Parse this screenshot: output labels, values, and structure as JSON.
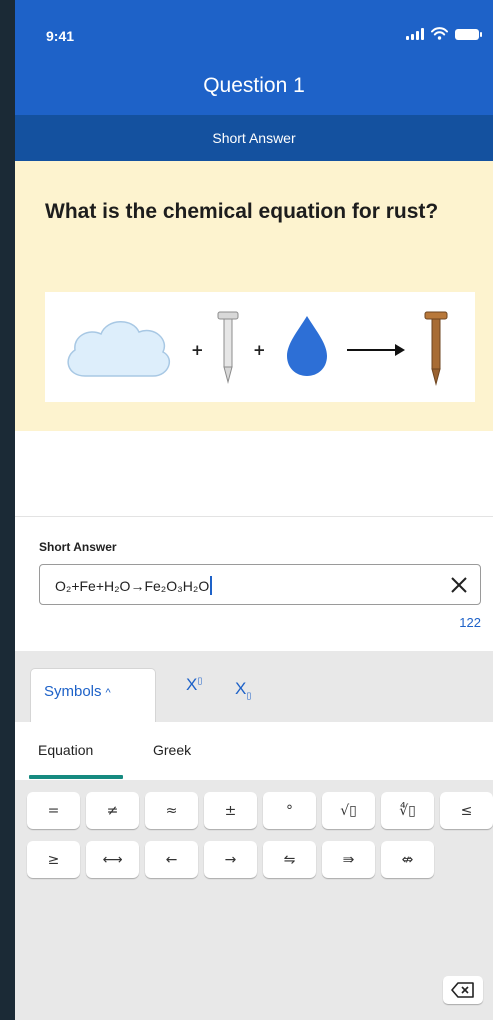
{
  "status": {
    "time": "9:41"
  },
  "header": {
    "title": "Question 1",
    "subtitle": "Short Answer"
  },
  "question": {
    "text": "What is the chemical equation for rust?"
  },
  "answer": {
    "label": "Short Answer",
    "value": "O₂+Fe+H₂O→Fe₂O₃H₂O",
    "char_count": "122"
  },
  "keyboard": {
    "tabs": {
      "symbols": "Symbols",
      "superscript": "X",
      "superscript_mark": "▯",
      "subscript": "X",
      "subscript_mark": "▯"
    },
    "categories": {
      "equation": "Equation",
      "greek": "Greek"
    },
    "row1": [
      "=",
      "≠",
      "≈",
      "±",
      "°",
      "√▯",
      "∜▯",
      "≤"
    ],
    "row2": [
      "≥",
      "⟷",
      "←",
      "→",
      "⇋",
      "⇛",
      "⇎"
    ]
  },
  "colors": {
    "accent": "#1e62c8",
    "header": "#1e62c8",
    "subheader": "#14519f",
    "question_bg": "#fdf3cf",
    "tab_underline": "#168a80"
  },
  "icons": [
    "signal-icon",
    "wifi-icon",
    "battery-icon",
    "clear-icon",
    "backspace-icon"
  ]
}
